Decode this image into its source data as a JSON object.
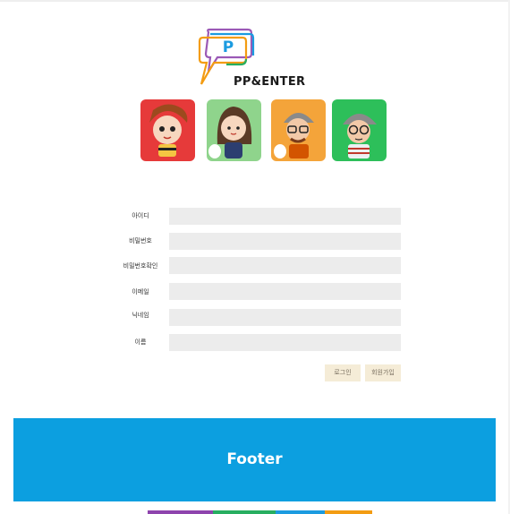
{
  "header": {
    "brand": "PP&ENTER",
    "logo_letter": "P"
  },
  "avatars": [
    {
      "name": "avatar-red",
      "bg": "#e63a3a"
    },
    {
      "name": "avatar-green-light",
      "bg": "#8fd48c"
    },
    {
      "name": "avatar-orange",
      "bg": "#f4a43a"
    },
    {
      "name": "avatar-green",
      "bg": "#2dbf5a"
    }
  ],
  "form": {
    "id_label": "아이디",
    "password_label": "비밀번호",
    "password_confirm_label": "비밀번호확인",
    "email_label": "이메일",
    "nickname_label": "닉네임",
    "name_label": "이름",
    "id_value": "",
    "password_value": "",
    "password_confirm_value": "",
    "email_value": "",
    "nickname_value": "",
    "name_value": ""
  },
  "buttons": {
    "login": "로그인",
    "signup": "회원가입"
  },
  "footer": {
    "text": "Footer"
  },
  "colors": {
    "footer_bg": "#0c9fe0",
    "bar_purple": "#8e44ad",
    "bar_green": "#27ae60",
    "bar_blue": "#1b9be0",
    "bar_orange": "#f39c12"
  }
}
